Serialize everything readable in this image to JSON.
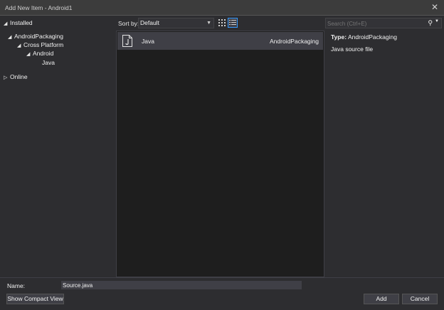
{
  "window": {
    "title": "Add New Item - Android1"
  },
  "tree": {
    "installed": "Installed",
    "android_packaging": "AndroidPackaging",
    "cross_platform": "Cross Platform",
    "android": "Android",
    "java": "Java",
    "online": "Online"
  },
  "sort": {
    "label": "Sort by:",
    "value": "Default"
  },
  "items": [
    {
      "name": "Java",
      "type": "AndroidPackaging",
      "icon": "java-file-icon"
    }
  ],
  "search": {
    "placeholder": "Search (Ctrl+E)"
  },
  "details": {
    "type_label": "Type:",
    "type_value": "AndroidPackaging",
    "description": "Java source file"
  },
  "footer": {
    "name_label": "Name:",
    "name_value": "Source.java",
    "compact_view": "Show Compact View",
    "add": "Add",
    "cancel": "Cancel"
  },
  "colors": {
    "accent": "#3399ff",
    "background": "#2d2d30",
    "list_background": "#1e1e1e",
    "selection": "#3f3f46"
  }
}
